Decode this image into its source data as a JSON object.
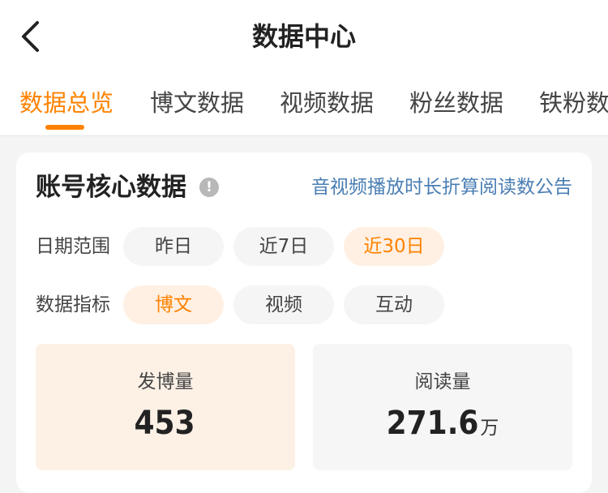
{
  "header": {
    "title": "数据中心",
    "back_icon": "chevron-left-icon"
  },
  "tabs": [
    {
      "label": "数据总览",
      "active": true
    },
    {
      "label": "博文数据",
      "active": false
    },
    {
      "label": "视频数据",
      "active": false
    },
    {
      "label": "粉丝数据",
      "active": false
    },
    {
      "label": "铁粉数据",
      "active": false
    }
  ],
  "section": {
    "title": "账号核心数据",
    "info_icon": "!",
    "notice_link": "音视频播放时长折算阅读数公告"
  },
  "date_range": {
    "label": "日期范围",
    "options": [
      "昨日",
      "近7日",
      "近30日"
    ],
    "selected": "近30日"
  },
  "metric": {
    "label": "数据指标",
    "options": [
      "博文",
      "视频",
      "互动"
    ],
    "selected": "博文"
  },
  "stats": [
    {
      "label": "发博量",
      "value": "453",
      "unit": ""
    },
    {
      "label": "阅读量",
      "value": "271.6",
      "unit": "万"
    }
  ],
  "colors": {
    "accent": "#ff8200",
    "accent_bg": "#fff0e3",
    "link": "#4a7eb3",
    "text": "#222222"
  }
}
